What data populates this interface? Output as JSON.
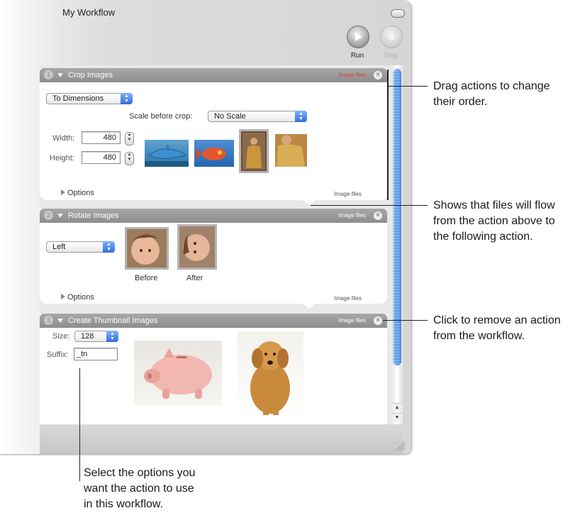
{
  "window": {
    "title": "My Workflow",
    "toolbar": {
      "run_label": "Run",
      "stop_label": "Stop"
    }
  },
  "actions": [
    {
      "number": "1",
      "title": "Crop Images",
      "input_type": "Image files",
      "mode_popup": "To Dimensions",
      "scale_label": "Scale before crop:",
      "scale_popup": "No Scale",
      "width_label": "Width:",
      "width_value": "480",
      "height_label": "Height:",
      "height_value": "480",
      "options_label": "Options",
      "output_type": "Image files"
    },
    {
      "number": "2",
      "title": "Rotate Images",
      "input_type": "Image files",
      "direction_popup": "Left",
      "before_label": "Before",
      "after_label": "After",
      "options_label": "Options",
      "output_type": "Image files"
    },
    {
      "number": "3",
      "title": "Create Thumbnail Images",
      "input_type": "Image files",
      "size_label": "Size:",
      "size_popup": "128",
      "suffix_label": "Suffix:",
      "suffix_value": "_tn"
    }
  ],
  "callouts": {
    "drag": [
      "Drag actions to change",
      "their order."
    ],
    "flow": [
      "Shows that files will flow",
      "from the action above to",
      "the following action."
    ],
    "remove": [
      "Click to remove an action",
      "from the workflow."
    ],
    "options": [
      "Select the options you",
      "want the action to use",
      "in this workflow."
    ]
  },
  "colors": {
    "action_header": "#9b9b9b",
    "scroll_thumb": "#5b9ce6",
    "popup_arrows": "#2f6fd8",
    "input_mismatch_text": "#e03a3a"
  },
  "icons": {
    "run": "play-icon",
    "stop": "stop-icon",
    "close": "close-icon",
    "disclosure": "disclosure-triangle-icon"
  }
}
